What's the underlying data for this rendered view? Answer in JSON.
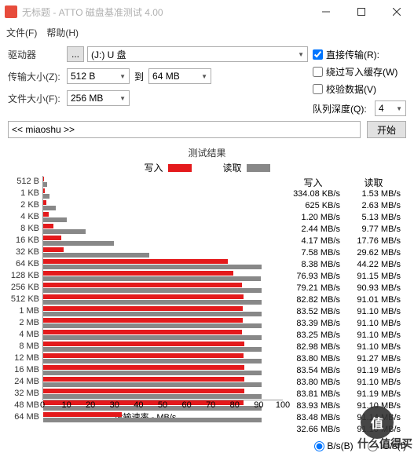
{
  "window": {
    "title": "无标题 - ATTO 磁盘基准测试 4.00"
  },
  "menu": {
    "file": "文件(F)",
    "help": "帮助(H)"
  },
  "form": {
    "drive_label": "驱动器",
    "drive_value": "(J:) U 盘",
    "ellipsis": "...",
    "xfer_label": "传输大小(Z):",
    "xfer_from": "512 B",
    "xfer_to_label": "到",
    "xfer_to": "64 MB",
    "file_label": "文件大小(F):",
    "file_value": "256 MB",
    "direct": "直接传输(R):",
    "bypass": "绕过写入缓存(W)",
    "verify": "校验数据(V)",
    "qd_label": "队列深度(Q):",
    "qd_value": "4",
    "desc": "<< miaoshu >>",
    "start": "开始"
  },
  "chart_data": {
    "type": "bar",
    "title": "测试结果",
    "legend_write": "写入",
    "legend_read": "读取",
    "xlabel": "传输速率 - MB/s",
    "xlim": [
      0,
      100
    ],
    "xticks": [
      0,
      10,
      20,
      30,
      40,
      50,
      60,
      70,
      80,
      90,
      100
    ],
    "categories": [
      "512 B",
      "1 KB",
      "2 KB",
      "4 KB",
      "8 KB",
      "16 KB",
      "32 KB",
      "64 KB",
      "128 KB",
      "256 KB",
      "512 KB",
      "1 MB",
      "2 MB",
      "4 MB",
      "8 MB",
      "12 MB",
      "16 MB",
      "24 MB",
      "32 MB",
      "48 MB",
      "64 MB"
    ],
    "series": [
      {
        "name": "写入",
        "unit_col": true,
        "values": [
          0.334,
          0.625,
          1.2,
          2.44,
          4.17,
          7.58,
          8.38,
          76.93,
          79.21,
          82.82,
          83.52,
          83.39,
          83.25,
          82.98,
          83.8,
          83.54,
          83.8,
          83.81,
          83.93,
          83.48,
          32.66
        ],
        "display": [
          "334.08 KB/s",
          "625 KB/s",
          "1.20 MB/s",
          "2.44 MB/s",
          "4.17 MB/s",
          "7.58 MB/s",
          "8.38 MB/s",
          "76.93 MB/s",
          "79.21 MB/s",
          "82.82 MB/s",
          "83.52 MB/s",
          "83.39 MB/s",
          "83.25 MB/s",
          "82.98 MB/s",
          "83.80 MB/s",
          "83.54 MB/s",
          "83.80 MB/s",
          "83.81 MB/s",
          "83.93 MB/s",
          "83.48 MB/s",
          "32.66 MB/s"
        ]
      },
      {
        "name": "读取",
        "values": [
          1.53,
          2.63,
          5.13,
          9.77,
          17.76,
          29.62,
          44.22,
          91.15,
          90.93,
          91.01,
          91.1,
          91.1,
          91.1,
          91.1,
          91.27,
          91.19,
          91.1,
          91.19,
          91.1,
          91.14,
          91.1
        ],
        "display": [
          "1.53 MB/s",
          "2.63 MB/s",
          "5.13 MB/s",
          "9.77 MB/s",
          "17.76 MB/s",
          "29.62 MB/s",
          "44.22 MB/s",
          "91.15 MB/s",
          "90.93 MB/s",
          "91.01 MB/s",
          "91.10 MB/s",
          "91.10 MB/s",
          "91.10 MB/s",
          "91.10 MB/s",
          "91.27 MB/s",
          "91.19 MB/s",
          "91.10 MB/s",
          "91.19 MB/s",
          "91.10 MB/s",
          "91.14 MB/s",
          "91.10 MB/s"
        ]
      }
    ]
  },
  "footer": {
    "bs": "B/s(B)",
    "ios": "IO/s(I)"
  },
  "watermark": {
    "icon": "值",
    "text": "什么值得买"
  }
}
